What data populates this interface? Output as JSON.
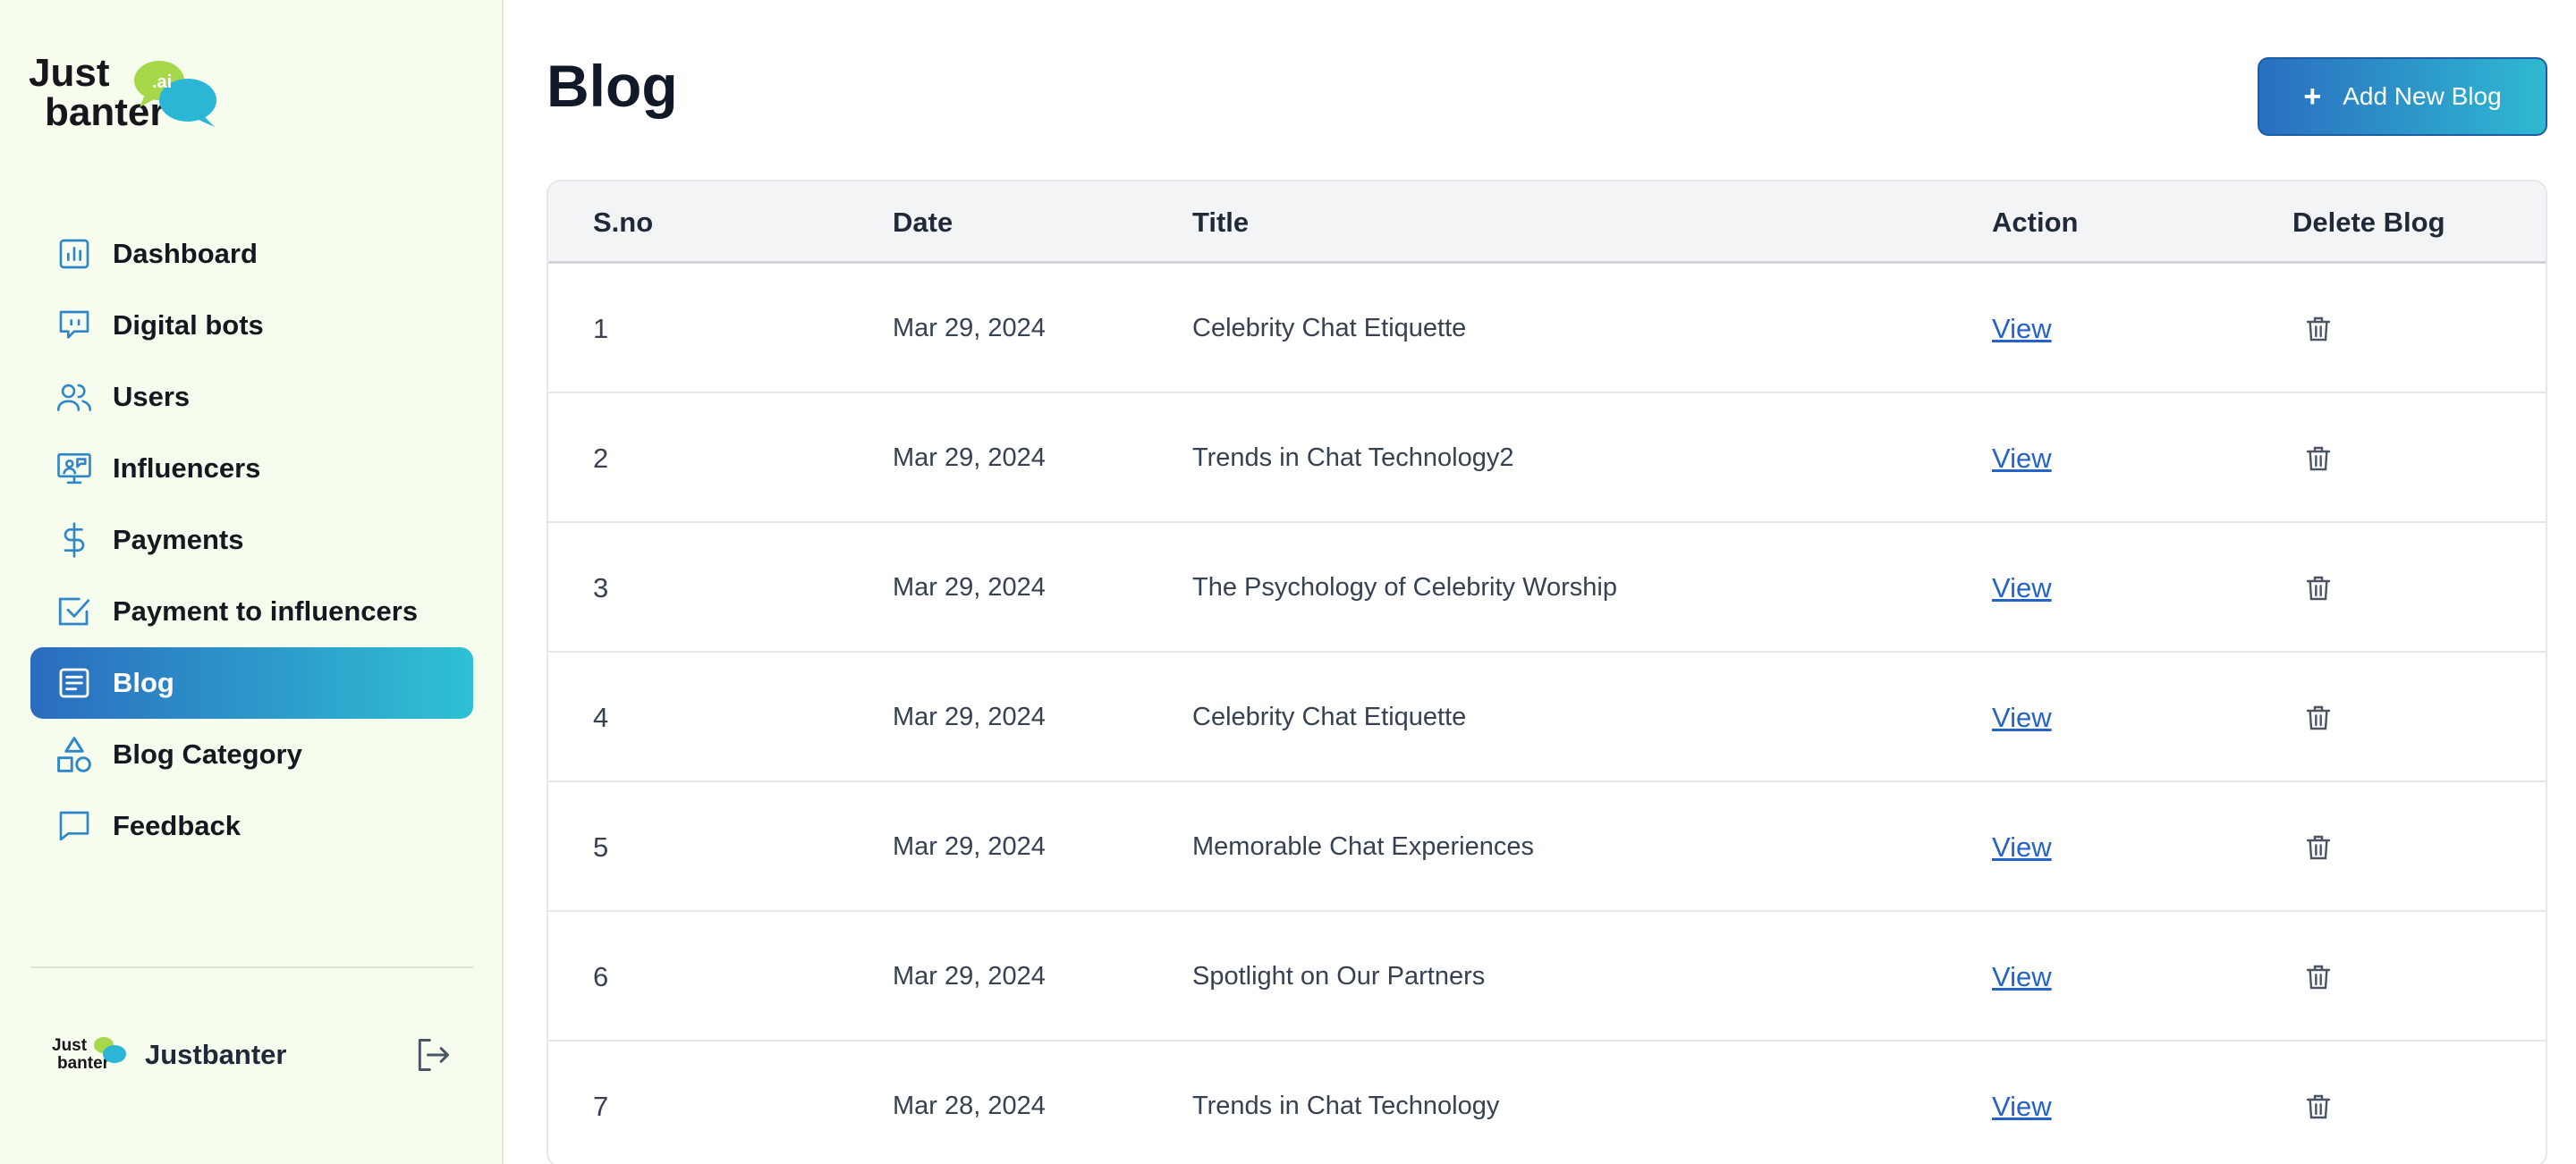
{
  "brand": {
    "line1": "Just",
    "line2": "banter",
    "badge": ".ai"
  },
  "sidebar": {
    "items": [
      {
        "label": "Dashboard",
        "icon": "chart-icon",
        "active": false
      },
      {
        "label": "Digital bots",
        "icon": "bot-chat-icon",
        "active": false
      },
      {
        "label": "Users",
        "icon": "users-icon",
        "active": false
      },
      {
        "label": "Influencers",
        "icon": "influencer-monitor-icon",
        "active": false
      },
      {
        "label": "Payments",
        "icon": "dollar-icon",
        "active": false
      },
      {
        "label": "Payment to influencers",
        "icon": "check-square-icon",
        "active": false
      },
      {
        "label": "Blog",
        "icon": "document-icon",
        "active": true
      },
      {
        "label": "Blog Category",
        "icon": "shapes-icon",
        "active": false
      },
      {
        "label": "Feedback",
        "icon": "message-icon",
        "active": false
      }
    ],
    "profile": {
      "name": "Justbanter",
      "logout_icon": "logout-icon"
    }
  },
  "main": {
    "title": "Blog",
    "add_button": "Add New Blog",
    "table": {
      "headers": [
        "S.no",
        "Date",
        "Title",
        "Action",
        "Delete Blog"
      ],
      "rows": [
        {
          "sno": "1",
          "date": "Mar 29, 2024",
          "title": "Celebrity Chat Etiquette",
          "action": "View"
        },
        {
          "sno": "2",
          "date": "Mar 29, 2024",
          "title": "Trends in Chat Technology2",
          "action": "View"
        },
        {
          "sno": "3",
          "date": "Mar 29, 2024",
          "title": "The Psychology of Celebrity Worship",
          "action": "View"
        },
        {
          "sno": "4",
          "date": "Mar 29, 2024",
          "title": "Celebrity Chat Etiquette",
          "action": "View"
        },
        {
          "sno": "5",
          "date": "Mar 29, 2024",
          "title": "Memorable Chat Experiences",
          "action": "View"
        },
        {
          "sno": "6",
          "date": "Mar 29, 2024",
          "title": "Spotlight on Our Partners",
          "action": "View"
        },
        {
          "sno": "7",
          "date": "Mar 28, 2024",
          "title": "Trends in Chat Technology",
          "action": "View"
        }
      ]
    }
  },
  "colors": {
    "sidebar_bg": "#f6fdee",
    "accent_start": "#2b6cbf",
    "accent_end": "#2ec1d4",
    "icon_blue": "#2f86c8",
    "link": "#2563c9"
  }
}
